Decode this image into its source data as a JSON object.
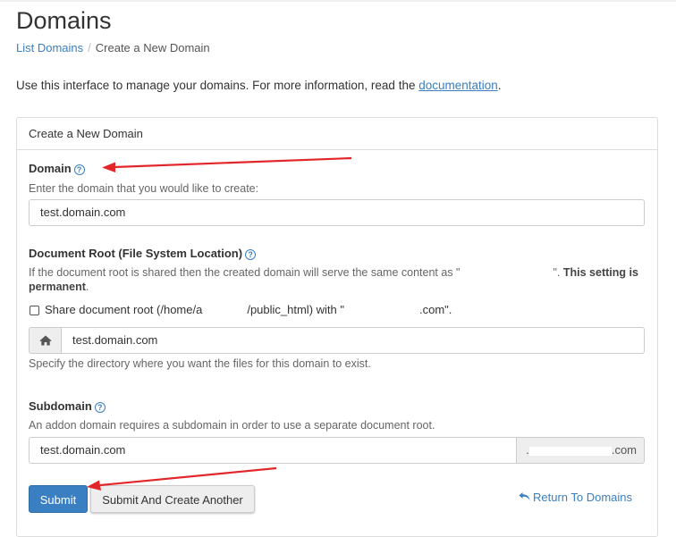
{
  "page": {
    "title": "Domains",
    "breadcrumb": {
      "parent": "List Domains",
      "separator": "/",
      "current": "Create a New Domain"
    },
    "intro_text": "Use this interface to manage your domains. For more information, read the ",
    "intro_link": "documentation",
    "intro_end": "."
  },
  "panel": {
    "heading": "Create a New Domain"
  },
  "domain": {
    "label": "Domain",
    "help": "?",
    "hint": "Enter the domain that you would like to create:",
    "value": "test.domain.com"
  },
  "document_root": {
    "label": "Document Root (File System Location)",
    "help": "?",
    "hint_start": "If the document root is shared then the created domain will serve the same content as \"",
    "hint_mid": "\".",
    "hint_bold": "This setting is permanent",
    "hint_end": ".",
    "share_label_start": "Share document root (/home/a",
    "share_label_mid": "/public_html) with \"",
    "share_label_end": ".com\".",
    "value": "test.domain.com",
    "dir_hint": "Specify the directory where you want the files for this domain to exist."
  },
  "subdomain": {
    "label": "Subdomain",
    "help": "?",
    "hint": "An addon domain requires a subdomain in order to use a separate document root.",
    "value": "test.domain.com",
    "suffix_start": ".",
    "suffix_end": ".com"
  },
  "buttons": {
    "submit": "Submit",
    "submit_another": "Submit And Create Another",
    "return": "Return To Domains"
  },
  "colors": {
    "link": "#3a7fc1",
    "primary_button": "#3a7fc1",
    "annotation_arrow": "#e3262a"
  }
}
